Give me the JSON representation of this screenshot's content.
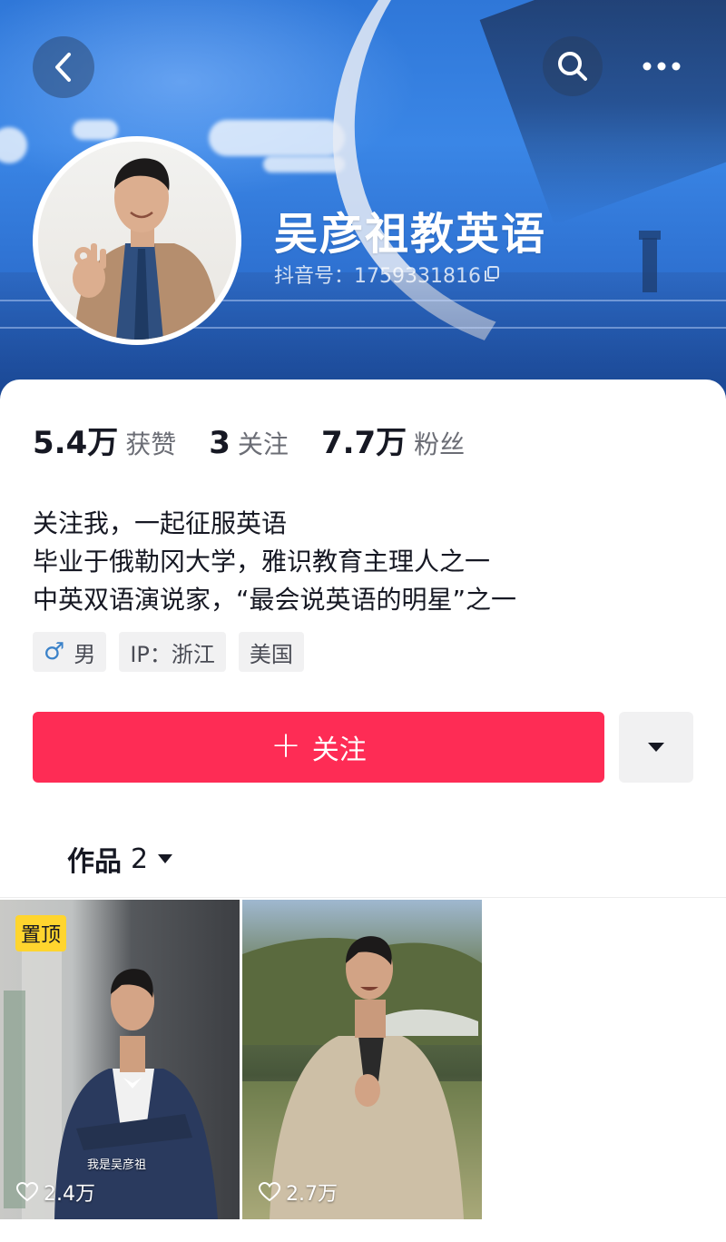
{
  "header": {
    "profile_name": "吴彦祖教英语",
    "account_id": "抖音号：1759331816",
    "back_icon": "chevron-left-icon",
    "search_icon": "search-icon",
    "more_icon": "more-dots-icon"
  },
  "stats": [
    {
      "value": "5.4万",
      "label": "获赞"
    },
    {
      "value": "3",
      "label": "关注"
    },
    {
      "value": "7.7万",
      "label": "粉丝"
    }
  ],
  "bio": [
    "关注我，一起征服英语",
    "毕业于俄勒冈大学，雅识教育主理人之一",
    "中英双语演说家，“最会说英语的明星”之一"
  ],
  "tags": {
    "gender_symbol": "♂",
    "gender": "男",
    "ip": "IP：浙江",
    "country": "美国"
  },
  "actions": {
    "follow_plus": "+",
    "follow_label": "关注"
  },
  "works": {
    "tab_label": "作品",
    "count": "2"
  },
  "videos": [
    {
      "badge": "置顶",
      "caption": "我是吴彦祖",
      "likes": "2.4万"
    },
    {
      "badge": "",
      "caption": "",
      "likes": "2.7万"
    }
  ],
  "colors": {
    "accent": "#fe2c55",
    "pin_badge": "#ffd52e",
    "banner": "#2f77d8"
  }
}
